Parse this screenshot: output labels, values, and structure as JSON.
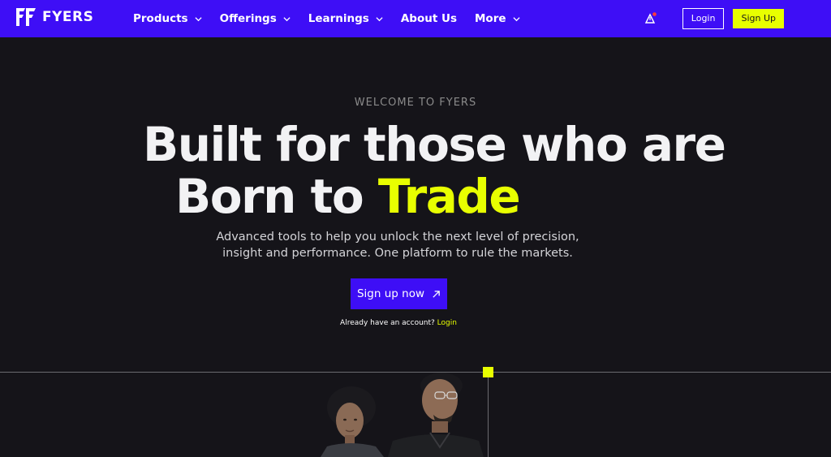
{
  "brand": {
    "name": "FYERS",
    "accent": "#e8ff00",
    "primary": "#3e0ef6",
    "background": "#151419"
  },
  "nav": {
    "items": [
      {
        "label": "Products",
        "has_dropdown": true
      },
      {
        "label": "Offerings",
        "has_dropdown": true
      },
      {
        "label": "Learnings",
        "has_dropdown": true
      },
      {
        "label": "About Us",
        "has_dropdown": false
      },
      {
        "label": "More",
        "has_dropdown": true
      }
    ],
    "alert_icon": "triangle-alert-icon",
    "login_label": "Login",
    "signup_label": "Sign Up"
  },
  "hero": {
    "eyebrow": "WELCOME TO FYERS",
    "headline_line1": "Built for those who are",
    "headline_line2_prefix": "Born to ",
    "headline_line2_accent": "Trade",
    "subtext_line1": "Advanced tools to help you unlock the next level of precision,",
    "subtext_line2": "insight and performance. One platform to rule the markets.",
    "cta_label": "Sign up now",
    "cta_icon": "arrow-up-right-icon",
    "account_prompt": "Already have an account? ",
    "account_login": "Login"
  }
}
